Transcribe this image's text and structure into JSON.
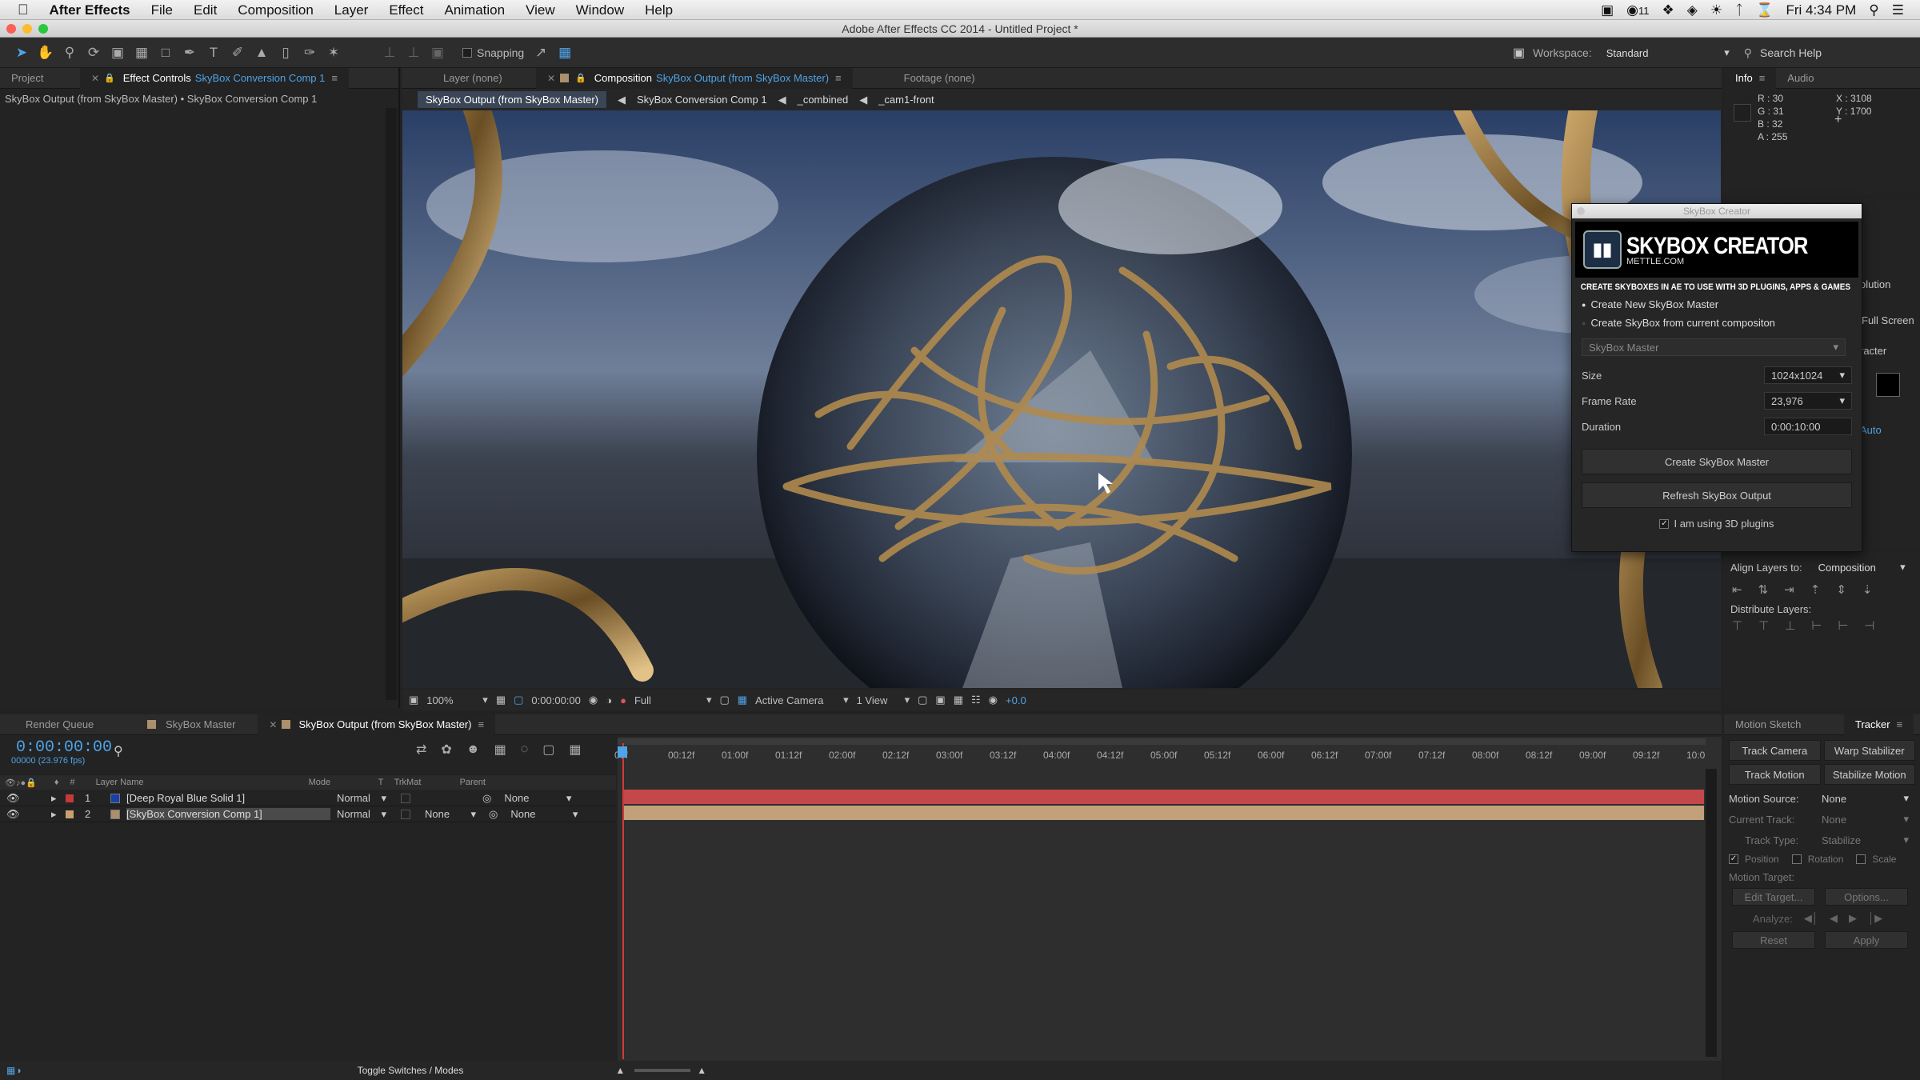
{
  "menubar": {
    "app": "After Effects",
    "items": [
      "File",
      "Edit",
      "Composition",
      "Layer",
      "Effect",
      "Animation",
      "View",
      "Window",
      "Help"
    ],
    "badge": "11",
    "clock": "Fri 4:34 PM"
  },
  "window": {
    "title": "Adobe After Effects CC 2014 - Untitled Project *"
  },
  "toolbar": {
    "snapping": "Snapping",
    "workspace_label": "Workspace:",
    "workspace_value": "Standard",
    "search": "Search Help"
  },
  "left_panel": {
    "tab_project": "Project",
    "tab_effect_prefix": "Effect Controls",
    "tab_effect_comp": "SkyBox Conversion Comp 1",
    "breadcrumb": "SkyBox Output (from SkyBox Master) • SkyBox Conversion Comp 1"
  },
  "comp_tabs": {
    "layer": "Layer (none)",
    "comp_prefix": "Composition",
    "comp_name": "SkyBox Output (from SkyBox Master)",
    "footage": "Footage (none)"
  },
  "flow": [
    "SkyBox Output (from SkyBox Master)",
    "SkyBox Conversion Comp 1",
    "_combined",
    "_cam1-front"
  ],
  "viewbar": {
    "zoom": "100%",
    "time": "0:00:00:00",
    "resolution": "Full",
    "camera": "Active Camera",
    "views": "1 View",
    "exposure": "+0.0"
  },
  "info": {
    "tab_info": "Info",
    "tab_audio": "Audio",
    "r": "R : 30",
    "g": "G : 31",
    "b": "B : 32",
    "a": "A : 255",
    "x": "X : 3108",
    "y": "Y : 1700"
  },
  "right_partial": {
    "solution": "olution",
    "fullscreen": "Full Screen",
    "character": "racter",
    "auto": "Auto"
  },
  "skybox": {
    "window_title": "SkyBox Creator",
    "brand": "SKYBOX CREATOR",
    "site": "METTLE.COM",
    "tagline": "CREATE SKYBOXES IN AE TO USE WITH 3D PLUGINS, APPS & GAMES",
    "opt1": "Create New SkyBox Master",
    "opt2": "Create SkyBox from current compositon",
    "master_select": "SkyBox Master",
    "size_label": "Size",
    "size_value": "1024x1024",
    "fps_label": "Frame Rate",
    "fps_value": "23,976",
    "dur_label": "Duration",
    "dur_value": "0:00:10:00",
    "btn_create": "Create SkyBox Master",
    "btn_refresh": "Refresh SkyBox Output",
    "check_label": "I am using 3D plugins"
  },
  "align": {
    "label": "Align Layers to:",
    "value": "Composition",
    "distribute": "Distribute Layers:"
  },
  "timeline_tabs": {
    "render": "Render Queue",
    "master": "SkyBox Master",
    "output": "SkyBox Output (from SkyBox Master)"
  },
  "timeline": {
    "timecode": "0:00:00:00",
    "fps": "00000 (23.976 fps)",
    "ticks": [
      "00f",
      "00:12f",
      "01:00f",
      "01:12f",
      "02:00f",
      "02:12f",
      "03:00f",
      "03:12f",
      "04:00f",
      "04:12f",
      "05:00f",
      "05:12f",
      "06:00f",
      "06:12f",
      "07:00f",
      "07:12f",
      "08:00f",
      "08:12f",
      "09:00f",
      "09:12f",
      "10:0"
    ],
    "col_layer": "Layer Name",
    "col_mode": "Mode",
    "col_t": "T",
    "col_trkmat": "TrkMat",
    "col_parent": "Parent",
    "layers": [
      {
        "num": "1",
        "name": "[Deep Royal Blue Solid 1]",
        "mode": "Normal",
        "trkmat": "",
        "parent": "None",
        "color": "#c23a3a"
      },
      {
        "num": "2",
        "name": "[SkyBox Conversion Comp 1]",
        "mode": "Normal",
        "trkmat": "None",
        "parent": "None",
        "color": "#c9a16e"
      }
    ],
    "toggle": "Toggle Switches / Modes"
  },
  "tracker": {
    "tab_motion": "Motion Sketch",
    "tab_tracker": "Tracker",
    "track_camera": "Track Camera",
    "warp": "Warp Stabilizer",
    "track_motion": "Track Motion",
    "stabilize": "Stabilize Motion",
    "source_label": "Motion Source:",
    "source_value": "None",
    "current_label": "Current Track:",
    "current_value": "None",
    "type_label": "Track Type:",
    "type_value": "Stabilize",
    "position": "Position",
    "rotation": "Rotation",
    "scale": "Scale",
    "target_label": "Motion Target:",
    "edit_target": "Edit Target...",
    "options": "Options...",
    "analyze": "Analyze:",
    "reset": "Reset",
    "apply": "Apply"
  }
}
